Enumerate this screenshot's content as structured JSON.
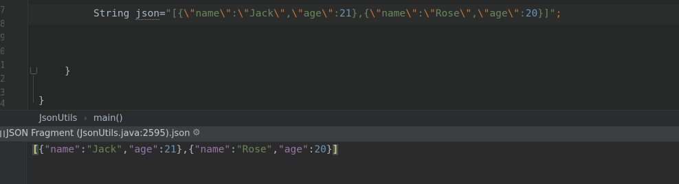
{
  "editor": {
    "line_numbers": [
      "7",
      "8",
      "9",
      "0",
      "1",
      "2",
      "3",
      "4"
    ],
    "code_line": {
      "type": "String",
      "var": "json",
      "assign": "=",
      "literal_open": "\"[{",
      "esc1": "\\\"",
      "t1": "name",
      "esc2": "\\\"",
      "t2": ":",
      "esc3": "\\\"",
      "t3": "Jack",
      "esc4": "\\\"",
      "t4": ",",
      "esc5": "\\\"",
      "t5": "age",
      "esc6": "\\\"",
      "t6": ":",
      "num1": "21",
      "t7": "},{",
      "esc7": "\\\"",
      "t8": "name",
      "esc8": "\\\"",
      "t9": ":",
      "esc9": "\\\"",
      "t10": "Rose",
      "esc10": "\\\"",
      "t11": ",",
      "esc11": "\\\"",
      "t12": "age",
      "esc12": "\\\"",
      "t13": ":",
      "num2": "20",
      "literal_close": "}]\"",
      "semicolon": ";"
    },
    "inner_brace": "}",
    "outer_brace": "}"
  },
  "breadcrumb": {
    "class_name": "JsonUtils",
    "separator": "›",
    "method_name": "main()"
  },
  "panel": {
    "title": "JSON Fragment (JsonUtils.java:2595).json",
    "gear_icon": "gear-icon"
  },
  "json_view": {
    "open_bracket": "[",
    "p1": "{",
    "k1": "\"name\"",
    "c1": ":",
    "v1": "\"Jack\"",
    "s1": ",",
    "k2": "\"age\"",
    "c2": ":",
    "n1": "21",
    "p2": "},{",
    "k3": "\"name\"",
    "c3": ":",
    "v2": "\"Rose\"",
    "s2": ",",
    "k4": "\"age\"",
    "c4": ":",
    "n2": "20",
    "p3": "}",
    "close_bracket": "]"
  }
}
